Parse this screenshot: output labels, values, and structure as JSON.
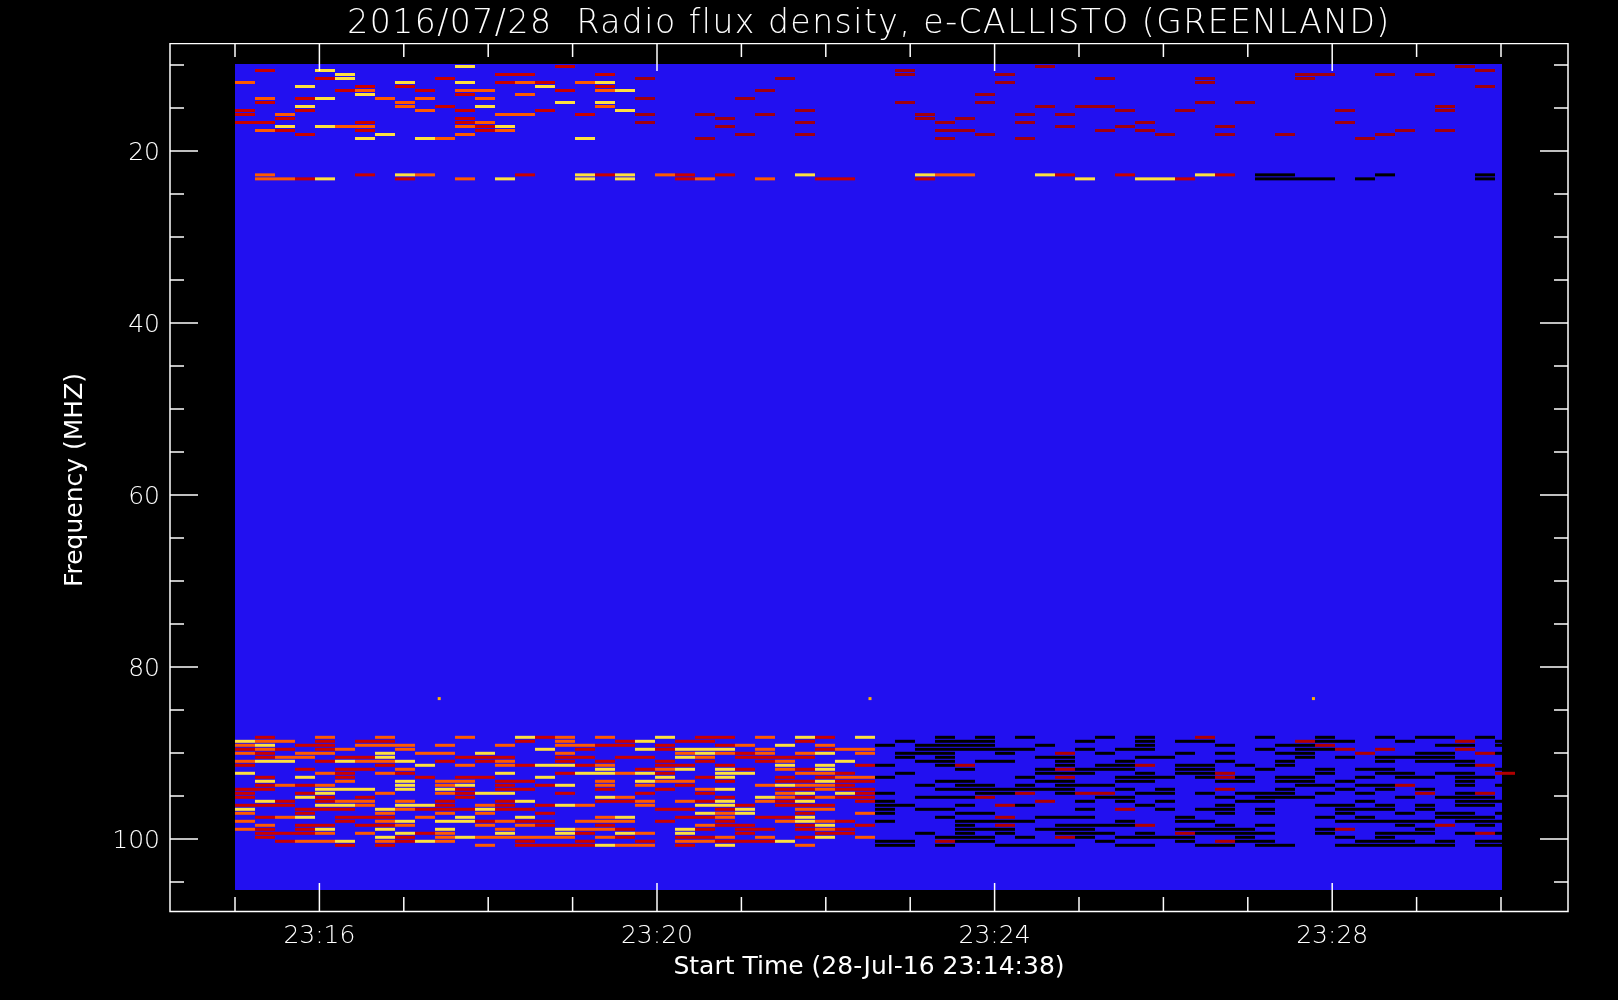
{
  "title": "2016/07/28  Radio flux density, e-CALLISTO (GREENLAND)",
  "y_axis": {
    "label": "Frequency (MHZ)",
    "ticks": [
      "20",
      "40",
      "60",
      "80",
      "100"
    ]
  },
  "x_axis": {
    "label": "Start Time (28-Jul-16 23:14:38)",
    "ticks": [
      "23:16",
      "23:20",
      "23:24",
      "23:28"
    ]
  }
}
